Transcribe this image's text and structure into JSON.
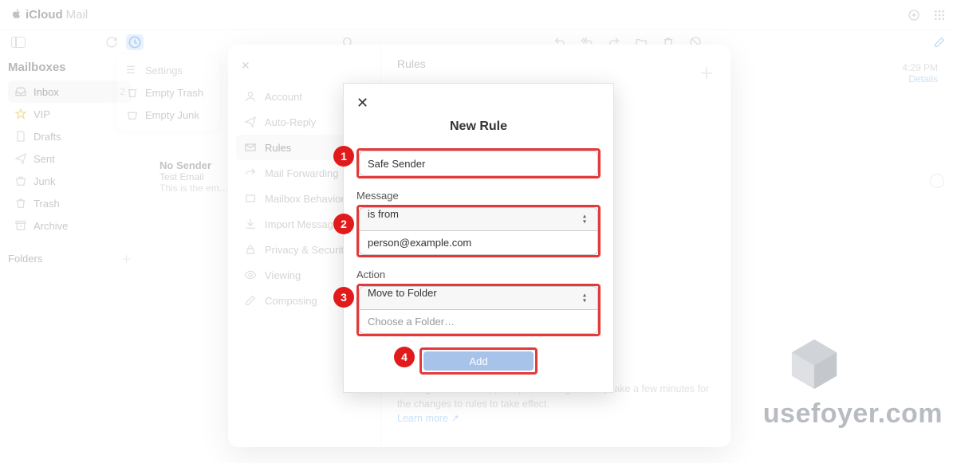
{
  "header": {
    "brand1": "iCloud",
    "brand2": "Mail"
  },
  "mailboxes": {
    "title": "Mailboxes",
    "folders_title": "Folders",
    "items": [
      {
        "label": "Inbox",
        "count": "2"
      },
      {
        "label": "VIP"
      },
      {
        "label": "Drafts"
      },
      {
        "label": "Sent"
      },
      {
        "label": "Junk"
      },
      {
        "label": "Trash"
      },
      {
        "label": "Archive"
      }
    ]
  },
  "settings_pop": {
    "title": "Settings",
    "items": [
      "Empty Trash",
      "Empty Junk"
    ]
  },
  "preview": {
    "sender": "No Sender",
    "subject": "Test Email",
    "body": "This is the em…"
  },
  "meta": {
    "time": "4:29 PM",
    "details": "Details"
  },
  "settings_panel": {
    "title": "Rules",
    "nav": [
      "Account",
      "Auto-Reply",
      "Rules",
      "Mail Forwarding",
      "Mailbox Behavior",
      "Import Messages",
      "Privacy & Security",
      "Viewing",
      "Composing"
    ],
    "help1": "…ching rule will be applied per message. It may take a few minutes for the changes to rules to take effect.",
    "help_link": "Learn more ↗"
  },
  "modal": {
    "title": "New Rule",
    "name_value": "Safe Sender",
    "message_label": "Message",
    "condition": "is from",
    "condition_value": "person@example.com",
    "action_label": "Action",
    "action": "Move to Folder",
    "action_value_placeholder": "Choose a Folder…",
    "add_label": "Add"
  },
  "steps": {
    "1": "1",
    "2": "2",
    "3": "3",
    "4": "4"
  },
  "watermark": "usefoyer.com"
}
